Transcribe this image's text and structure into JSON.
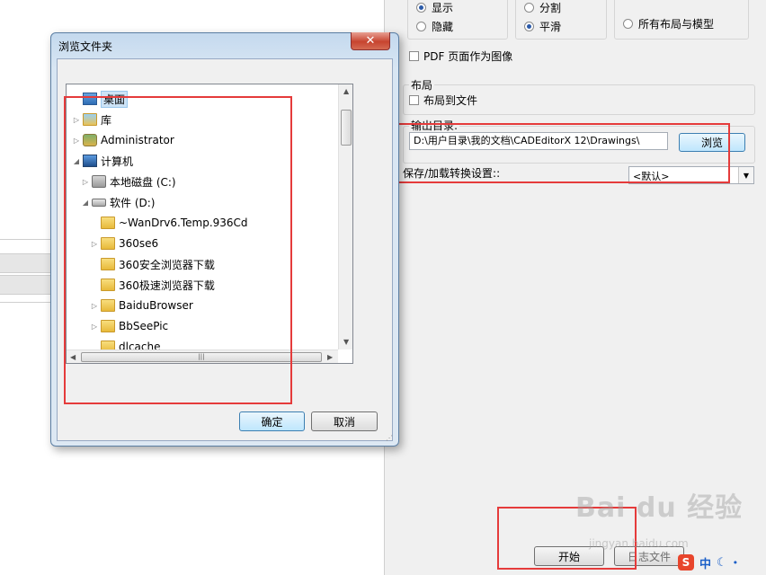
{
  "right_panel": {
    "radio_show": "显示",
    "radio_hide": "隐藏",
    "radio_split": "分割",
    "radio_smooth": "平滑",
    "radio_all_layouts": "所有布局与模型",
    "pdf_as_image": "PDF 页面作为图像",
    "layout_group_label": "布局",
    "layout_to_file": "布局到文件",
    "output_dir_label": "输出目录:",
    "output_dir_value": "D:\\用户目录\\我的文档\\CADEditorX 12\\Drawings\\",
    "browse_button": "浏览",
    "save_load_label": "保存/加载转换设置::",
    "save_load_select": "<默认>",
    "start_button": "开始",
    "log_file_button": "日志文件"
  },
  "dialog": {
    "title": "浏览文件夹",
    "close_glyph": "✕",
    "ok_button": "确定",
    "cancel_button": "取消",
    "tree": [
      {
        "label": "桌面"
      },
      {
        "label": "库"
      },
      {
        "label": "Administrator"
      },
      {
        "label": "计算机"
      },
      {
        "label": "本地磁盘 (C:)"
      },
      {
        "label": "软件 (D:)"
      },
      {
        "label": "~WanDrv6.Temp.936Cd"
      },
      {
        "label": "360se6"
      },
      {
        "label": "360安全浏览器下载"
      },
      {
        "label": "360极速浏览器下载"
      },
      {
        "label": "BaiduBrowser"
      },
      {
        "label": "BbSeePic"
      },
      {
        "label": "dlcache"
      }
    ]
  },
  "tray": {
    "ime_logo": "S",
    "ime_mode": "中"
  },
  "watermark": {
    "brand": "Bai du 经验",
    "url": "jingyan.baidu.com"
  }
}
